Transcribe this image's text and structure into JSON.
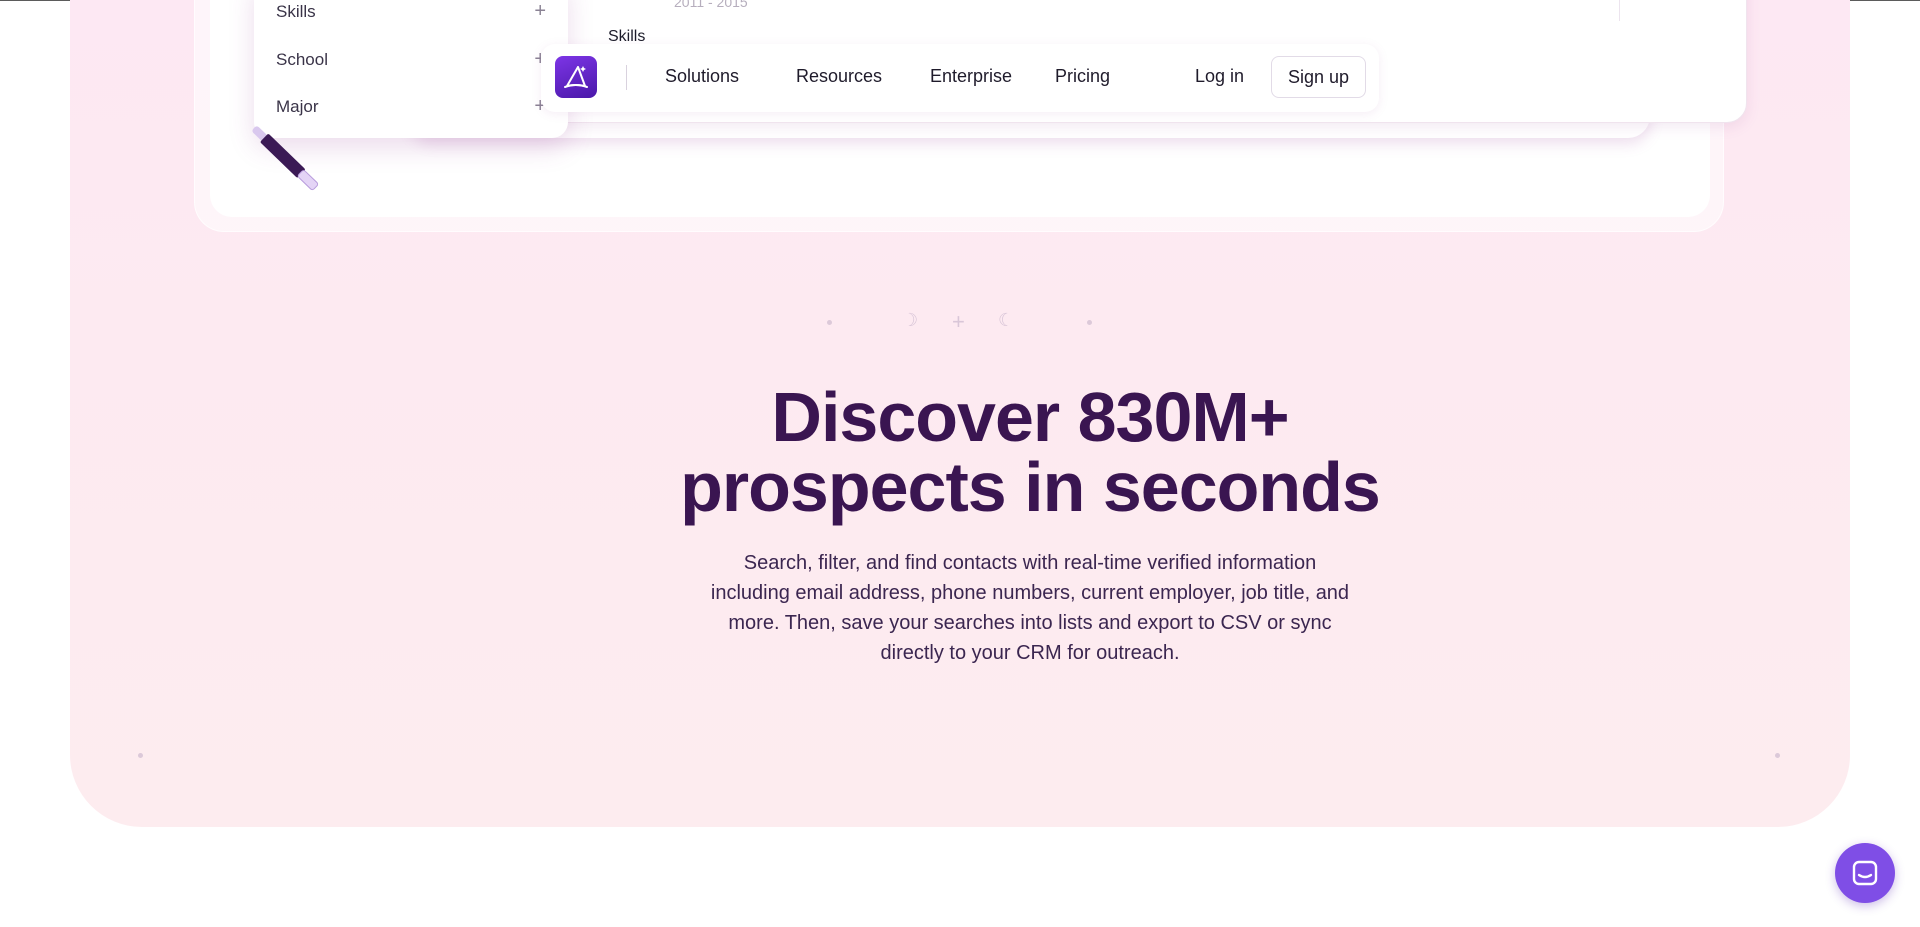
{
  "mockup": {
    "years": "2011 - 2015",
    "skills_heading": "Skills",
    "filters": [
      {
        "label": "Skills"
      },
      {
        "label": "School"
      },
      {
        "label": "Major"
      }
    ],
    "plus_glyph": "+"
  },
  "navbar": {
    "logo_icon": "wizard-hat-logo-icon",
    "items": [
      {
        "label": "Solutions"
      },
      {
        "label": "Resources"
      },
      {
        "label": "Enterprise"
      },
      {
        "label": "Pricing"
      }
    ],
    "login_label": "Log in",
    "signup_label": "Sign up"
  },
  "hero": {
    "decoration_glyphs": [
      "☽",
      "+",
      "☾"
    ],
    "headline_line1": "Discover 830M+",
    "headline_line2": "prospects in seconds",
    "subtext": "Search, filter, and find contacts with real-time verified information including email address, phone numbers, current employer, job title, and more. Then, save your searches into lists and export to CSV or sync directly to your CRM for outreach."
  },
  "chat": {
    "icon": "chat-bubble-icon"
  },
  "colors": {
    "hero_bg": "#fde8f3",
    "headline": "#3a1551",
    "brand": "#7f4ee6"
  }
}
